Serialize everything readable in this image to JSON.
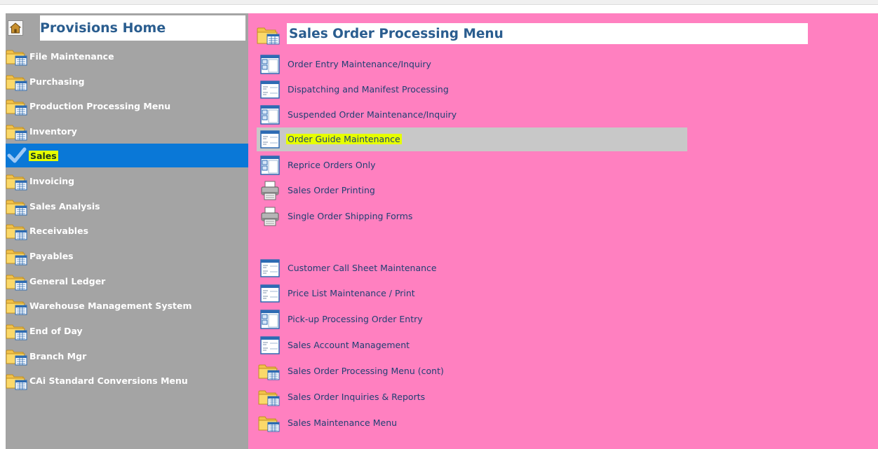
{
  "sidebar": {
    "title": "Provisions Home",
    "items": [
      {
        "label": "File Maintenance",
        "icon": "folder-icon",
        "selected": false
      },
      {
        "label": "Purchasing",
        "icon": "folder-icon",
        "selected": false
      },
      {
        "label": "Production Processing Menu",
        "icon": "folder-icon",
        "selected": false
      },
      {
        "label": "Inventory",
        "icon": "folder-icon",
        "selected": false
      },
      {
        "label": "Sales",
        "icon": "checkmark-icon",
        "selected": true
      },
      {
        "label": "Invoicing",
        "icon": "folder-icon",
        "selected": false
      },
      {
        "label": "Sales Analysis",
        "icon": "folder-icon",
        "selected": false
      },
      {
        "label": "Receivables",
        "icon": "folder-icon",
        "selected": false
      },
      {
        "label": "Payables",
        "icon": "folder-icon",
        "selected": false
      },
      {
        "label": "General Ledger",
        "icon": "folder-icon",
        "selected": false
      },
      {
        "label": "Warehouse Management System",
        "icon": "folder-icon",
        "selected": false
      },
      {
        "label": "End of Day",
        "icon": "folder-icon",
        "selected": false
      },
      {
        "label": "Branch Mgr",
        "icon": "folder-icon",
        "selected": false
      },
      {
        "label": "CAi Standard Conversions Menu",
        "icon": "folder-icon",
        "selected": false
      }
    ]
  },
  "main": {
    "title": "Sales Order Processing Menu",
    "items": [
      {
        "label": "Order Entry Maintenance/Inquiry",
        "icon": "form-window-icon"
      },
      {
        "label": "Dispatching and Manifest Processing",
        "icon": "list-window-icon"
      },
      {
        "label": "Suspended Order Maintenance/Inquiry",
        "icon": "form-window-icon"
      },
      {
        "label": "Order Guide Maintenance",
        "icon": "list-window-icon",
        "highlighted": true
      },
      {
        "label": "Reprice Orders Only",
        "icon": "form-window-icon"
      },
      {
        "label": "Sales Order Printing",
        "icon": "printer-icon"
      },
      {
        "label": "Single Order Shipping Forms",
        "icon": "printer-icon"
      },
      {
        "label": "Customer Call Sheet Maintenance",
        "icon": "list-window-icon"
      },
      {
        "label": "Price List Maintenance / Print",
        "icon": "list-window-icon"
      },
      {
        "label": "Pick-up Processing Order Entry",
        "icon": "form-window-icon"
      },
      {
        "label": "Sales Account Management",
        "icon": "list-window-icon"
      },
      {
        "label": "Sales Order Processing Menu (cont)",
        "icon": "folder-icon"
      },
      {
        "label": "Sales Order Inquiries & Reports",
        "icon": "folder-icon"
      },
      {
        "label": "Sales Maintenance Menu",
        "icon": "folder-icon"
      }
    ]
  },
  "colors": {
    "sidebar_bg": "#a4a4a4",
    "main_bg": "#ff80c0",
    "selected_bg": "#0a78d7",
    "highlight_yellow": "#e6ff00",
    "title_blue": "#2a5d8f"
  }
}
